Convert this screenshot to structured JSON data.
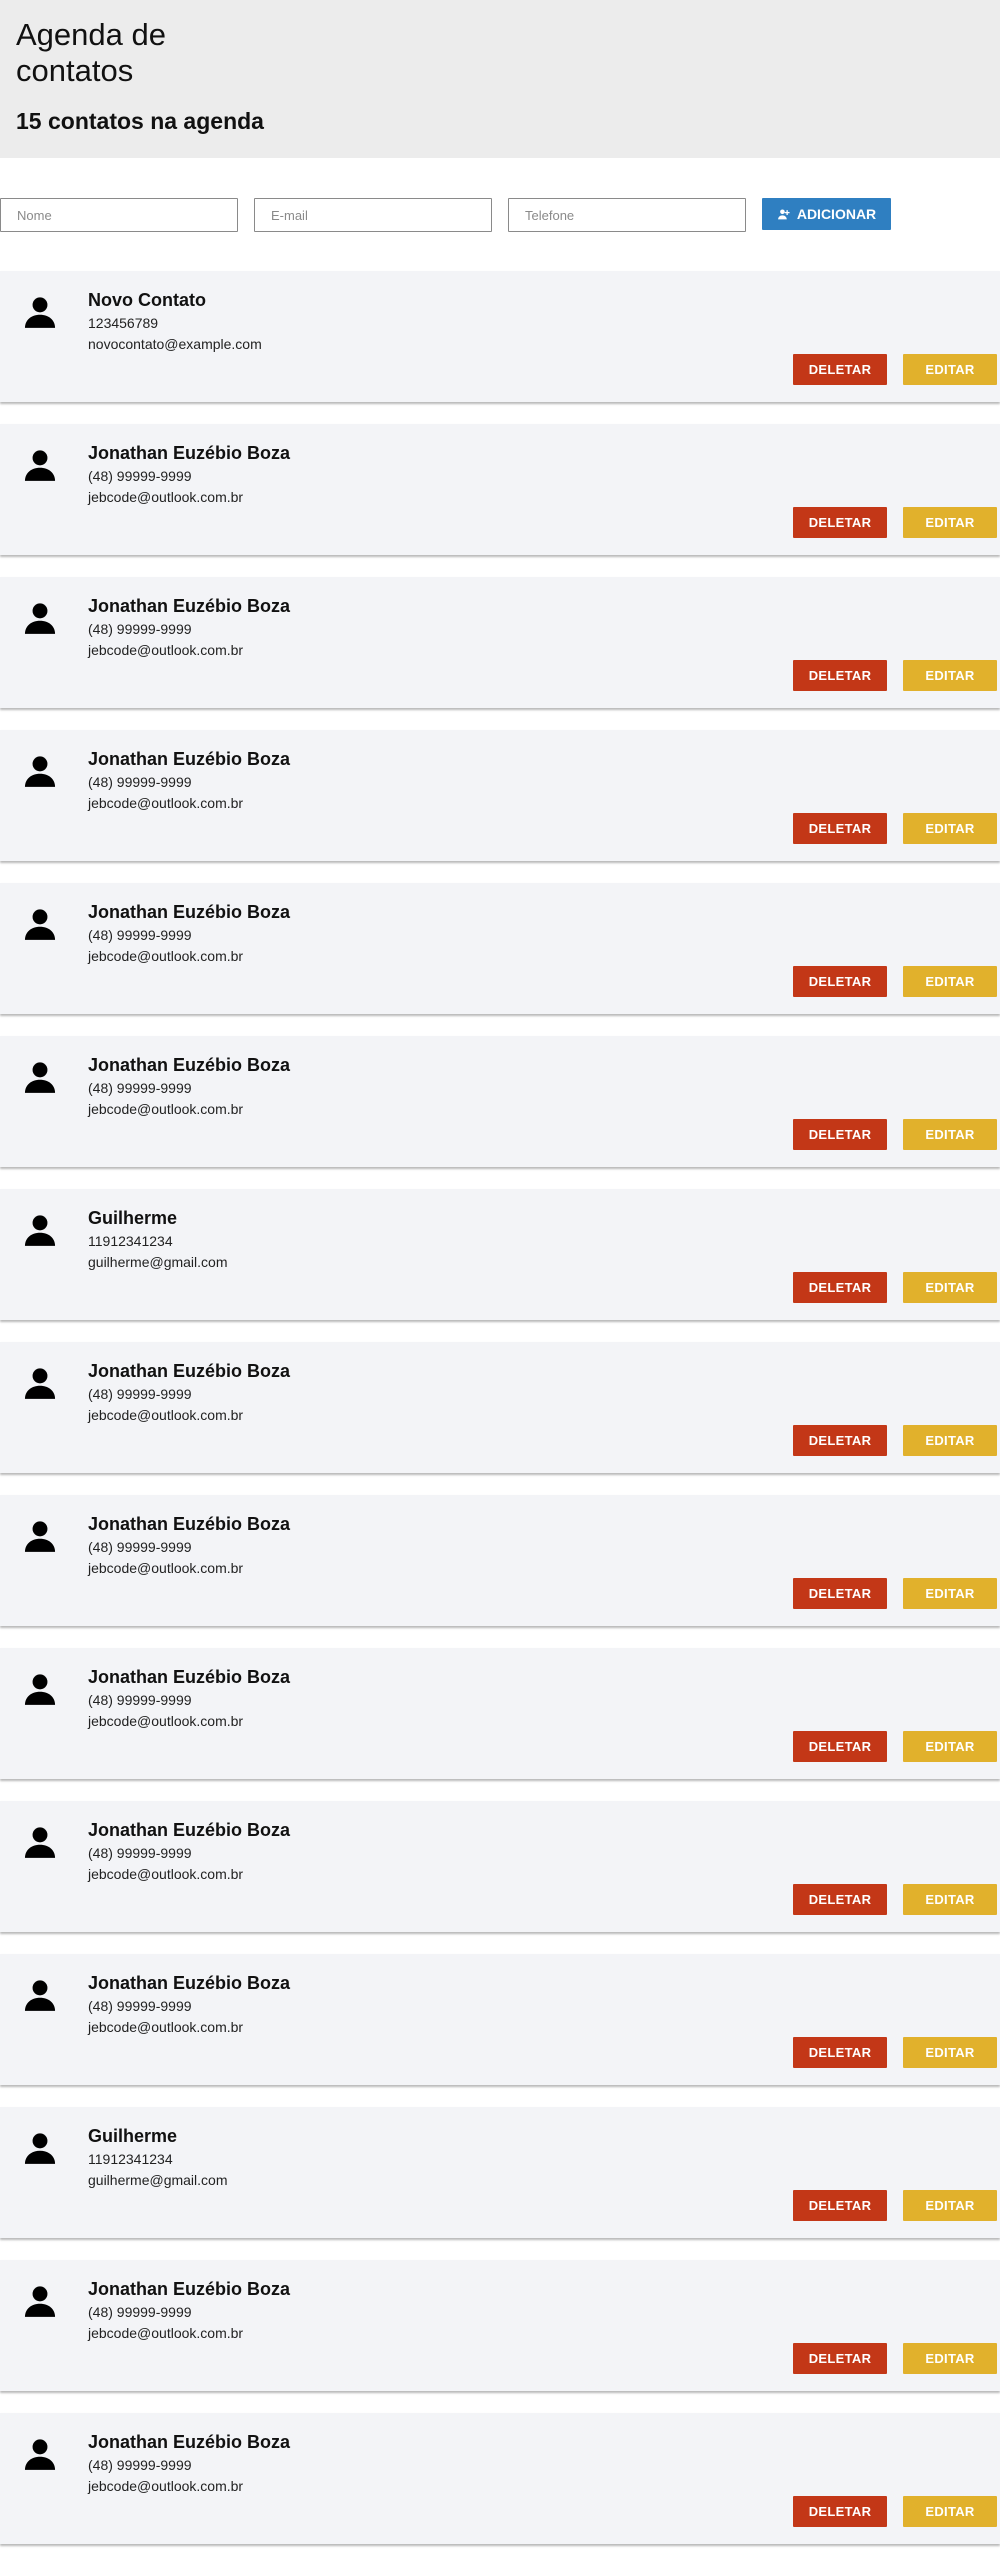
{
  "header": {
    "title": "Agenda de contatos",
    "count_text": "15 contatos na agenda"
  },
  "form": {
    "name_placeholder": "Nome",
    "email_placeholder": "E-mail",
    "phone_placeholder": "Telefone",
    "add_label": "ADICIONAR"
  },
  "colors": {
    "add_button": "#2f7fc1",
    "delete_button": "#c33717",
    "edit_button": "#e1b12c",
    "card_background": "#f3f4f7",
    "header_background": "#ececec"
  },
  "icons": {
    "avatar": "person-icon",
    "add": "add-user-icon"
  },
  "card_actions": {
    "delete_label": "DELETAR",
    "edit_label": "EDITAR"
  },
  "contacts": [
    {
      "name": "Novo Contato",
      "phone": "123456789",
      "email": "novocontato@example.com"
    },
    {
      "name": "Jonathan Euzébio Boza",
      "phone": "(48) 99999-9999",
      "email": "jebcode@outlook.com.br"
    },
    {
      "name": "Jonathan Euzébio Boza",
      "phone": "(48) 99999-9999",
      "email": "jebcode@outlook.com.br"
    },
    {
      "name": "Jonathan Euzébio Boza",
      "phone": "(48) 99999-9999",
      "email": "jebcode@outlook.com.br"
    },
    {
      "name": "Jonathan Euzébio Boza",
      "phone": "(48) 99999-9999",
      "email": "jebcode@outlook.com.br"
    },
    {
      "name": "Jonathan Euzébio Boza",
      "phone": "(48) 99999-9999",
      "email": "jebcode@outlook.com.br"
    },
    {
      "name": "Guilherme",
      "phone": "11912341234",
      "email": "guilherme@gmail.com"
    },
    {
      "name": "Jonathan Euzébio Boza",
      "phone": "(48) 99999-9999",
      "email": "jebcode@outlook.com.br"
    },
    {
      "name": "Jonathan Euzébio Boza",
      "phone": "(48) 99999-9999",
      "email": "jebcode@outlook.com.br"
    },
    {
      "name": "Jonathan Euzébio Boza",
      "phone": "(48) 99999-9999",
      "email": "jebcode@outlook.com.br"
    },
    {
      "name": "Jonathan Euzébio Boza",
      "phone": "(48) 99999-9999",
      "email": "jebcode@outlook.com.br"
    },
    {
      "name": "Jonathan Euzébio Boza",
      "phone": "(48) 99999-9999",
      "email": "jebcode@outlook.com.br"
    },
    {
      "name": "Guilherme",
      "phone": "11912341234",
      "email": "guilherme@gmail.com"
    },
    {
      "name": "Jonathan Euzébio Boza",
      "phone": "(48) 99999-9999",
      "email": "jebcode@outlook.com.br"
    },
    {
      "name": "Jonathan Euzébio Boza",
      "phone": "(48) 99999-9999",
      "email": "jebcode@outlook.com.br"
    }
  ]
}
